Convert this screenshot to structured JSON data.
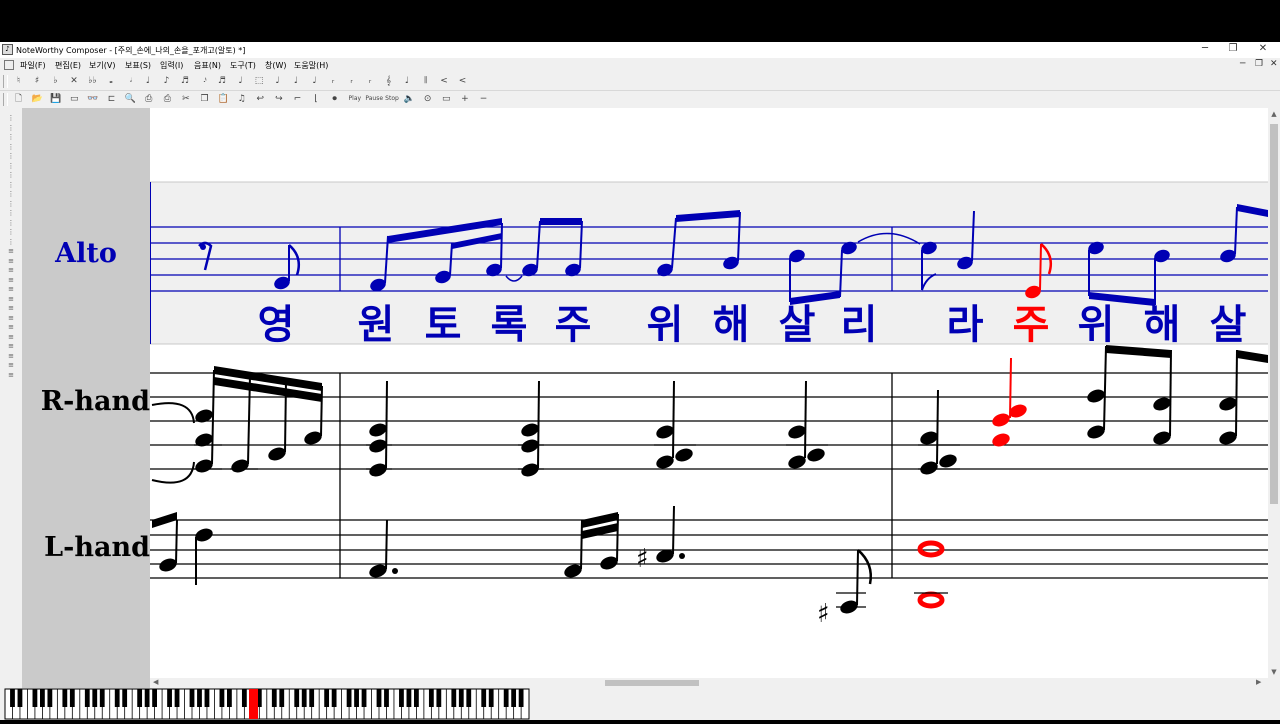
{
  "window": {
    "title": "NoteWorthy Composer - [주의_손에_나의_손을_포개고(알토) *]",
    "controls": {
      "minimize": "─",
      "maximize": "❐",
      "close": "✕"
    }
  },
  "menu": {
    "items": [
      "파일(F)",
      "편집(E)",
      "보기(V)",
      "보표(S)",
      "입력(I)",
      "음표(N)",
      "도구(T)",
      "창(W)",
      "도움말(H)"
    ],
    "mdi_controls": {
      "minimize": "─",
      "restore": "❐",
      "close": "✕"
    }
  },
  "toolbar1": {
    "icons": [
      "♮",
      "♯",
      "♭",
      "✕",
      "♭♭",
      "𝅝",
      "𝅗𝅥",
      "♩",
      "♪",
      "♬",
      "𝅘𝅥𝅯",
      "♬",
      "♩",
      "⬚",
      "♩",
      "♩",
      "♩",
      "ᵣ",
      "ᵣ",
      "ᵣ",
      "𝄞",
      "♩",
      "𝄂",
      "<",
      "<"
    ]
  },
  "toolbar2": {
    "icons": [
      "🗋",
      "📂",
      "💾",
      "▭",
      "👓",
      "⊏",
      "🔍",
      "⎙",
      "⎙",
      "✂",
      "❐",
      "📋",
      "♫",
      "↩",
      "↪",
      "⌐",
      "⌊",
      "⏺",
      "Play",
      "Pause",
      "Stop",
      "🔈",
      "⊙",
      "▭",
      "+",
      "−"
    ]
  },
  "staves": [
    {
      "name": "Alto",
      "color": "#0000b4"
    },
    {
      "name": "R-hand",
      "color": "#000000"
    },
    {
      "name": "L-hand",
      "color": "#000000"
    }
  ],
  "lyrics": {
    "syllables": [
      "영",
      "원",
      "토",
      "록",
      "주",
      "위",
      "해",
      "살",
      "리",
      "라",
      "주",
      "위",
      "해",
      "살"
    ],
    "highlight_index": 10,
    "color": "#0000b4",
    "highlight_color": "#ff0000"
  },
  "colors": {
    "alto": "#0000b4",
    "current": "#ff0000",
    "gutter": "#cacaca"
  }
}
